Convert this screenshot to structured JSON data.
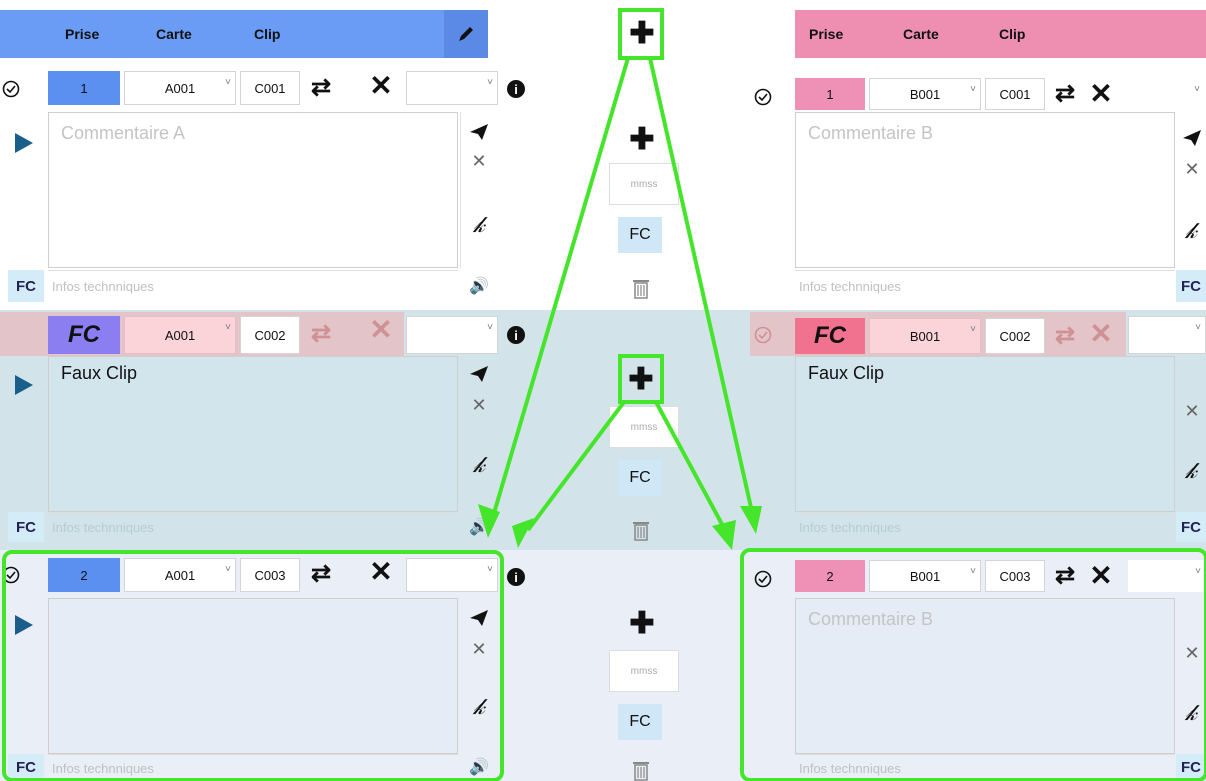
{
  "header": {
    "a": {
      "prise": "Prise",
      "carte": "Carte",
      "clip": "Clip"
    },
    "b": {
      "prise": "Prise",
      "carte": "Carte",
      "clip": "Clip"
    }
  },
  "colors": {
    "header_a": "#6b9cf5",
    "header_b": "#ee8fb2",
    "prise_a": "#5b8ff0",
    "prise_b": "#ef90b6",
    "highlight": "#44e52a",
    "band_fc": "#d3e3ea",
    "band_row3": "#e9eef7"
  },
  "rows": [
    {
      "a": {
        "prise": "1",
        "carte": "A001",
        "clip": "C001",
        "comment": "Commentaire A",
        "infos": "Infos technniques"
      },
      "b": {
        "prise": "1",
        "carte": "B001",
        "clip": "C001",
        "comment": "Commentaire B",
        "infos": "Infos technniques"
      },
      "mid": {
        "mmss": "mmss",
        "fc": "FC"
      }
    },
    {
      "a": {
        "prise": "FC",
        "carte": "A001",
        "clip": "C002",
        "comment": "Faux Clip",
        "infos": "Infos technniques"
      },
      "b": {
        "prise": "FC",
        "carte": "B001",
        "clip": "C002",
        "comment": "Faux Clip",
        "infos": "Infos technniques"
      },
      "mid": {
        "mmss": "mmss",
        "fc": "FC"
      }
    },
    {
      "a": {
        "prise": "2",
        "carte": "A001",
        "clip": "C003",
        "comment": "",
        "infos": "Infos technniques"
      },
      "b": {
        "prise": "2",
        "carte": "B001",
        "clip": "C003",
        "comment": "Commentaire B",
        "infos": "Infos technniques"
      },
      "mid": {
        "mmss": "mmss",
        "fc": "FC"
      }
    }
  ],
  "fc_label": "FC",
  "icons": [
    "check-circle-icon",
    "play-icon",
    "swap-icon",
    "close-icon",
    "info-icon",
    "send-icon",
    "pen-icon",
    "sound-icon",
    "trash-icon",
    "plus-icon",
    "pencil-icon"
  ]
}
